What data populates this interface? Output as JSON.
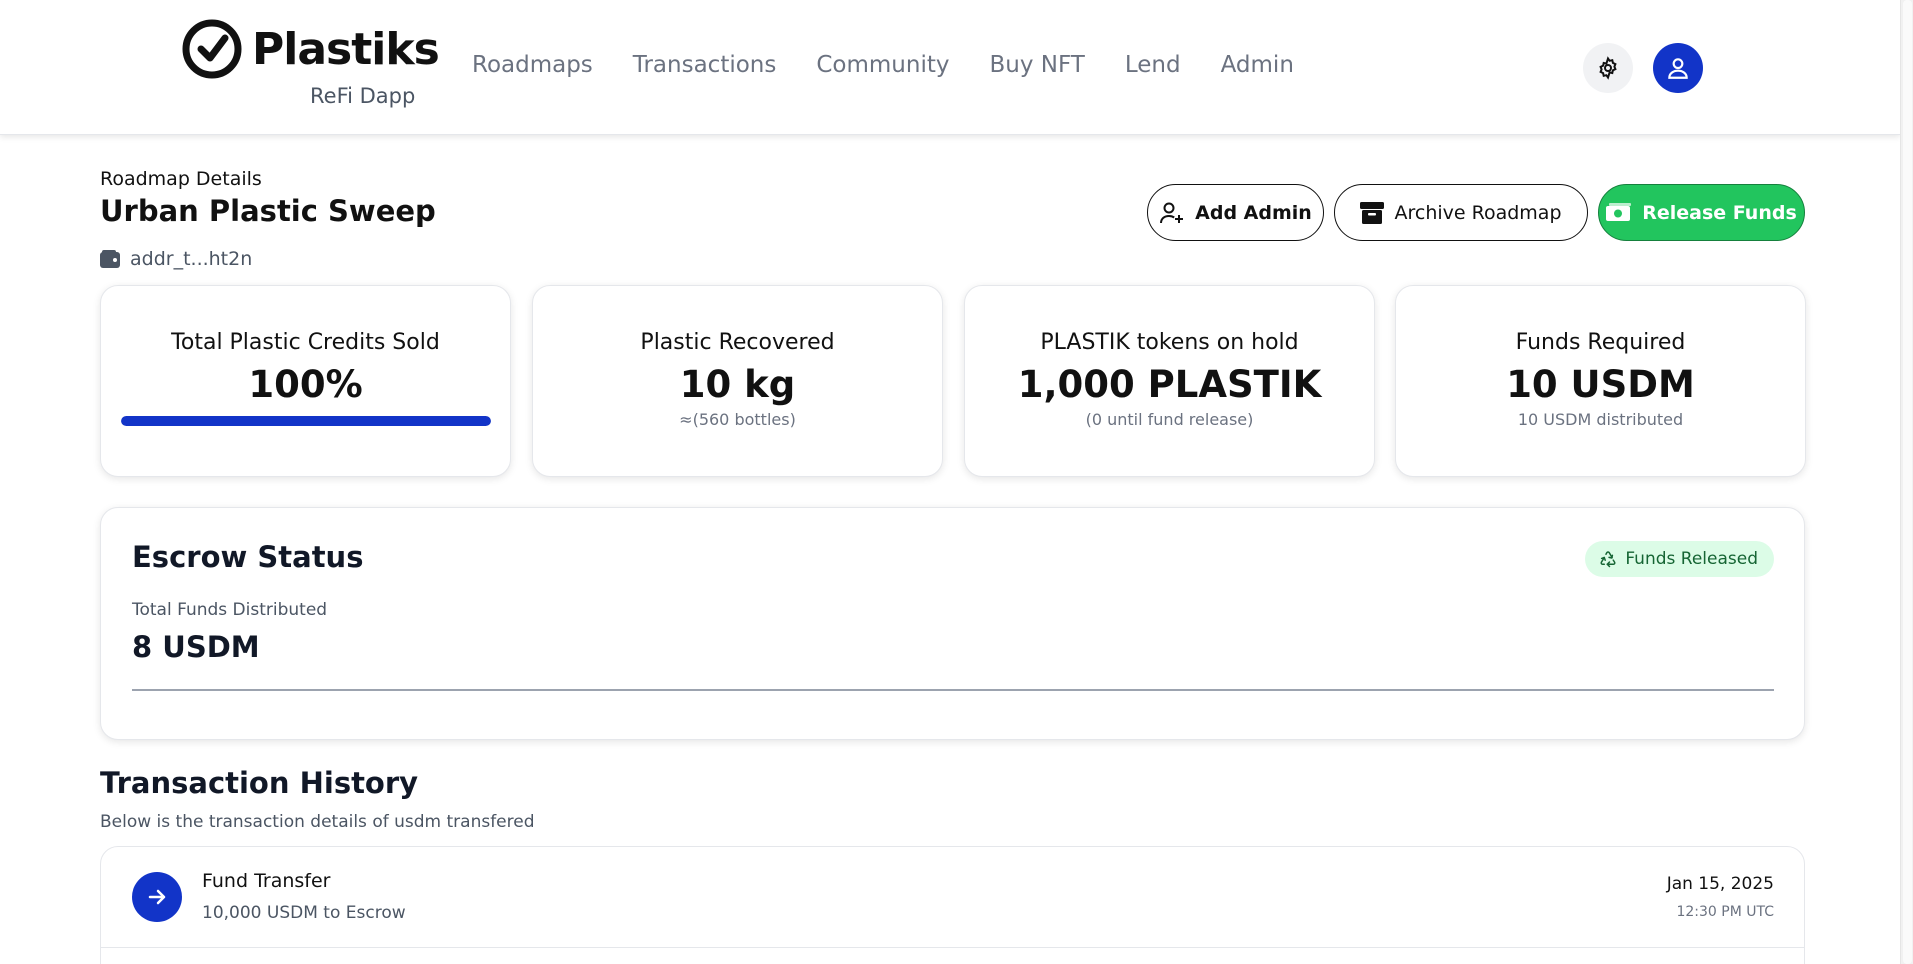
{
  "header": {
    "logo_text": "Plastiks",
    "logo_sub": "ReFi Dapp",
    "nav": [
      "Roadmaps",
      "Transactions",
      "Community",
      "Buy NFT",
      "Lend",
      "Admin"
    ],
    "settings_icon": "gear-icon",
    "profile_icon": "user-icon"
  },
  "page": {
    "breadcrumb": "Roadmap Details",
    "title": "Urban Plastic Sweep",
    "address": "addr_t...ht2n"
  },
  "actions": {
    "add_admin": "Add Admin",
    "archive": "Archive Roadmap",
    "release": "Release Funds"
  },
  "stats": [
    {
      "label": "Total Plastic Credits Sold",
      "value": "100%",
      "progress": 1.0
    },
    {
      "label": "Plastic Recovered",
      "value": "10 kg",
      "sub": "≈(560 bottles)"
    },
    {
      "label": "PLASTIK tokens on hold",
      "value": "1,000 PLASTIK",
      "sub": "(0 until fund release)"
    },
    {
      "label": "Funds Required",
      "value": "10 USDM",
      "sub": "10 USDM distributed"
    }
  ],
  "escrow": {
    "title": "Escrow Status",
    "badge": "Funds Released",
    "label": "Total Funds Distributed",
    "value": "8 USDM"
  },
  "transactions": {
    "title": "Transaction History",
    "subtitle": "Below is the transaction details of usdm transfered",
    "items": [
      {
        "name": "Fund Transfer",
        "desc": "10,000 USDM to Escrow",
        "date": "Jan 15, 2025",
        "time": "12:30 PM UTC"
      }
    ]
  },
  "colors": {
    "accent": "#1234c8",
    "release": "#22c55e",
    "badge_bg": "#dcfce7",
    "badge_text": "#166534"
  }
}
